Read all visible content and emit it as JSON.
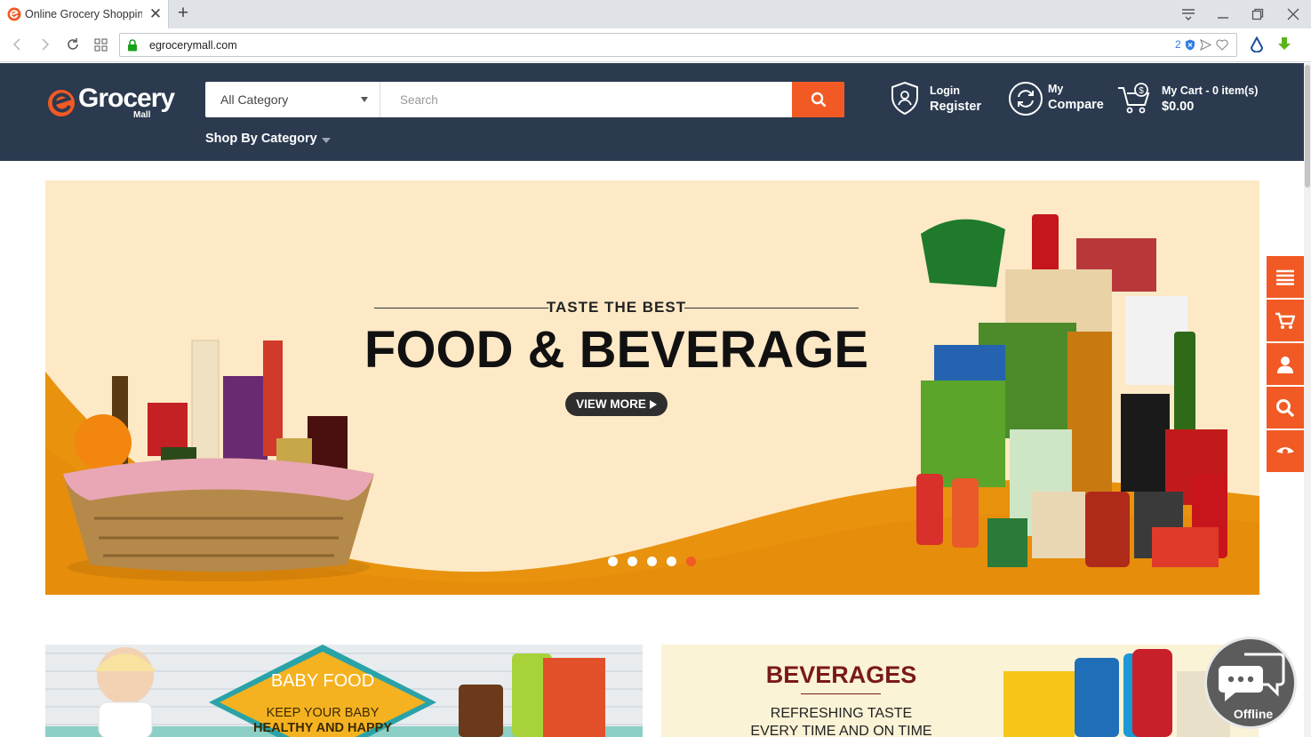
{
  "browser": {
    "tab_title": "Online Grocery Shopping",
    "url": "egrocerymall.com",
    "url_badge_count": "2"
  },
  "header": {
    "logo_word": "Grocery",
    "logo_sub": "Mall",
    "category_select": "All Category",
    "search_placeholder": "Search",
    "shop_by_category": "Shop By Category",
    "login": "Login",
    "register": "Register",
    "compare_top": "My",
    "compare": "Compare",
    "cart_label": "My Cart - 0 item(s)",
    "cart_total": "$0.00"
  },
  "banner": {
    "tagline": "TASTE THE BEST",
    "headline": "FOOD & BEVERAGE",
    "cta": "VIEW MORE",
    "slides": 5,
    "active_slide": 5
  },
  "promos": {
    "baby_title": "BABY FOOD",
    "baby_sub_1": "KEEP YOUR BABY",
    "baby_sub_2": "HEALTHY AND HAPPY",
    "bev_title": "BEVERAGES",
    "bev_sub_1": "REFRESHING TASTE",
    "bev_sub_2": "EVERY TIME AND ON TIME"
  },
  "chat": {
    "status": "Offline"
  },
  "colors": {
    "accent": "#f15a24",
    "header_bg": "#2b3a4f",
    "banner_bg": "#fde9c6",
    "banner_wave": "#e8920e"
  },
  "icons": [
    "menu-icon",
    "cart-icon",
    "user-icon",
    "search-icon",
    "eye-icon",
    "shield-user-icon",
    "compare-arrows-icon",
    "shopping-cart-icon",
    "chat-bubble-icon"
  ]
}
